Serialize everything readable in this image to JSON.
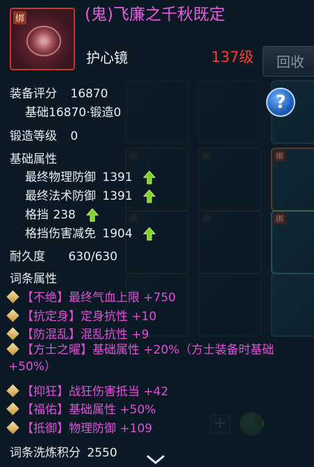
{
  "background": {
    "recycle_button": "回收",
    "cell_bind_label": "绑"
  },
  "item": {
    "bind_label": "绑",
    "name": "(鬼)飞廉之千秋既定",
    "type": "护心镜",
    "level": "137级"
  },
  "stats": {
    "score_label": "装备评分",
    "score_value": "16870",
    "score_breakdown": "基础16870·锻造0",
    "forge_level_label": "锻造等级",
    "forge_level_value": "0",
    "base_attrs_label": "基础属性",
    "base_attrs": [
      {
        "name": "最终物理防御",
        "value": "1391",
        "arrow": true
      },
      {
        "name": "最终法术防御",
        "value": "1391",
        "arrow": true
      },
      {
        "name": "格挡",
        "value": "238",
        "arrow": true
      },
      {
        "name": "格挡伤害减免",
        "value": "1904",
        "arrow": true
      }
    ],
    "durability_label": "耐久度",
    "durability_value": "630/630",
    "affix_label": "词条属性",
    "affixes": [
      "【不绝】最终气血上限 +750",
      "【抗定身】定身抗性 +10",
      "【防混乱】混乱抗性 +9",
      "【方士之曜】基础属性 +20%（方士装备时基础 +50%）",
      "【抑狂】战狂伤害抵当 +42",
      "【福佑】基础属性 +50%",
      "【抵御】物理防御 +109"
    ],
    "refine_label": "词条洗炼积分",
    "refine_value": "2550"
  },
  "colors": {
    "item_name": "#e85ce0",
    "level": "#ff3b2f",
    "affix": "#e050d8",
    "up_arrow": "#7ed321"
  },
  "icons": {
    "help": "question-mark-icon",
    "arrow": "green-up-arrow-icon",
    "bullet": "gold-diamond-icon",
    "scroll": "chevron-down-icon"
  }
}
